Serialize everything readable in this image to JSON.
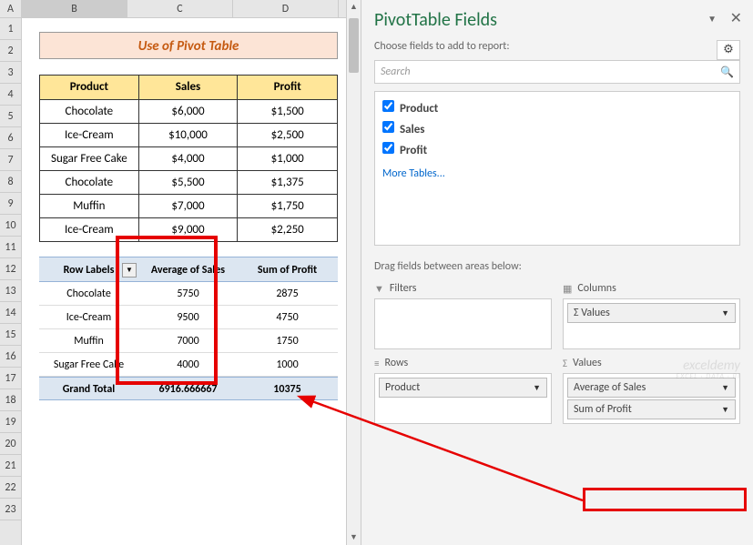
{
  "sheet": {
    "cols": [
      "A",
      "B",
      "C",
      "D"
    ],
    "rows": [
      "1",
      "2",
      "3",
      "4",
      "5",
      "6",
      "7",
      "8",
      "9",
      "10",
      "11",
      "12",
      "13",
      "14",
      "15",
      "16",
      "17",
      "18",
      "19",
      "20",
      "21",
      "22",
      "23"
    ],
    "title": "Use of Pivot Table",
    "headers": {
      "product": "Product",
      "sales": "Sales",
      "profit": "Profit"
    },
    "data": [
      {
        "product": "Chocolate",
        "sales": "$6,000",
        "profit": "$1,500"
      },
      {
        "product": "Ice-Cream",
        "sales": "$10,000",
        "profit": "$2,500"
      },
      {
        "product": "Sugar Free Cake",
        "sales": "$4,000",
        "profit": "$1,000"
      },
      {
        "product": "Chocolate",
        "sales": "$5,500",
        "profit": "$1,375"
      },
      {
        "product": "Muffin",
        "sales": "$7,000",
        "profit": "$1,750"
      },
      {
        "product": "Ice-Cream",
        "sales": "$9,000",
        "profit": "$2,250"
      }
    ],
    "pivot": {
      "headers": {
        "rowlabels": "Row Labels",
        "avg": "Average of Sales",
        "sum": "Sum of Profit"
      },
      "rows": [
        {
          "label": "Chocolate",
          "avg": "5750",
          "sum": "2875"
        },
        {
          "label": "Ice-Cream",
          "avg": "9500",
          "sum": "4750"
        },
        {
          "label": "Muffin",
          "avg": "7000",
          "sum": "1750"
        },
        {
          "label": "Sugar Free Cake",
          "avg": "4000",
          "sum": "1000"
        }
      ],
      "grand": {
        "label": "Grand Total",
        "avg": "6916.666667",
        "sum": "10375"
      }
    }
  },
  "pane": {
    "title": "PivotTable Fields",
    "subtitle": "Choose fields to add to report:",
    "search_placeholder": "Search",
    "fields": [
      {
        "name": "Product",
        "checked": true
      },
      {
        "name": "Sales",
        "checked": true
      },
      {
        "name": "Profit",
        "checked": true
      }
    ],
    "more_tables": "More Tables...",
    "drag_label": "Drag fields between areas below:",
    "areas": {
      "filters": {
        "title": "Filters",
        "items": []
      },
      "columns": {
        "title": "Columns",
        "items": [
          {
            "label": "Σ Values"
          }
        ]
      },
      "rows": {
        "title": "Rows",
        "items": [
          {
            "label": "Product"
          }
        ]
      },
      "values": {
        "title": "Values",
        "items": [
          {
            "label": "Average of Sales"
          },
          {
            "label": "Sum of Profit"
          }
        ]
      }
    }
  },
  "watermark": {
    "main": "exceldemy",
    "sub": "EXCEL · DATA · BI"
  },
  "icons": {
    "sigma": "Σ",
    "funnel": "▼",
    "cols": "▦",
    "rows": "≡",
    "gear": "⚙",
    "search": "🔍",
    "dropdown": "▼",
    "close": "✕",
    "chev": "▼"
  }
}
